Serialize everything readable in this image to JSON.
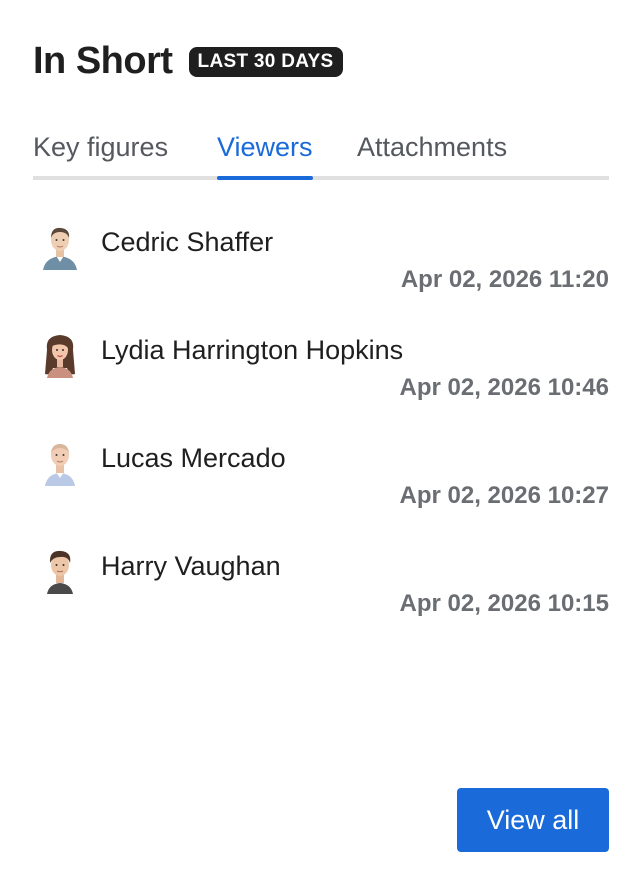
{
  "header": {
    "title": "In Short",
    "badge": "LAST 30 DAYS"
  },
  "tabs": [
    {
      "label": "Key figures",
      "active": false
    },
    {
      "label": "Viewers",
      "active": true
    },
    {
      "label": "Attachments",
      "active": false
    }
  ],
  "viewers": [
    {
      "name": "Cedric Shaffer",
      "time": "Apr 02, 2026 11:20",
      "avatar": "man-short-hair-avatar"
    },
    {
      "name": "Lydia Harrington Hopkins",
      "time": "Apr 02, 2026 10:46",
      "avatar": "woman-long-hair-avatar"
    },
    {
      "name": "Lucas Mercado",
      "time": "Apr 02, 2026 10:27",
      "avatar": "man-bald-avatar"
    },
    {
      "name": "Harry Vaughan",
      "time": "Apr 02, 2026 10:15",
      "avatar": "man-styled-hair-avatar"
    }
  ],
  "actions": {
    "view_all_label": "View all"
  },
  "colors": {
    "accent": "#1a6ad9",
    "badge_bg": "#1f1f1f",
    "tab_divider": "#e0e0e0"
  }
}
